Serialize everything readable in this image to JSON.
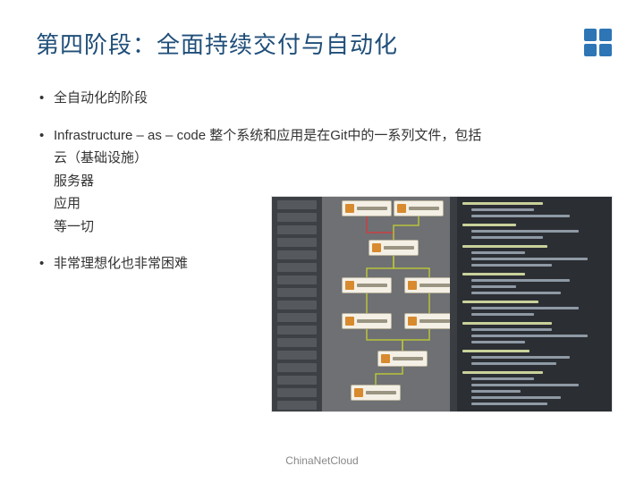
{
  "title": "第四阶段：全面持续交付与自动化",
  "bullets": {
    "b1": "全自动化的阶段",
    "b2_line1": "Infrastructure – as – code 整个系统和应用是在Git中的一系列文件，包括",
    "b2_sub1": "云（基础设施）",
    "b2_sub2": "服务器",
    "b2_sub3": "应用",
    "b2_sub4": "等一切",
    "b3": "非常理想化也非常困难"
  },
  "footer": "ChinaNetCloud"
}
